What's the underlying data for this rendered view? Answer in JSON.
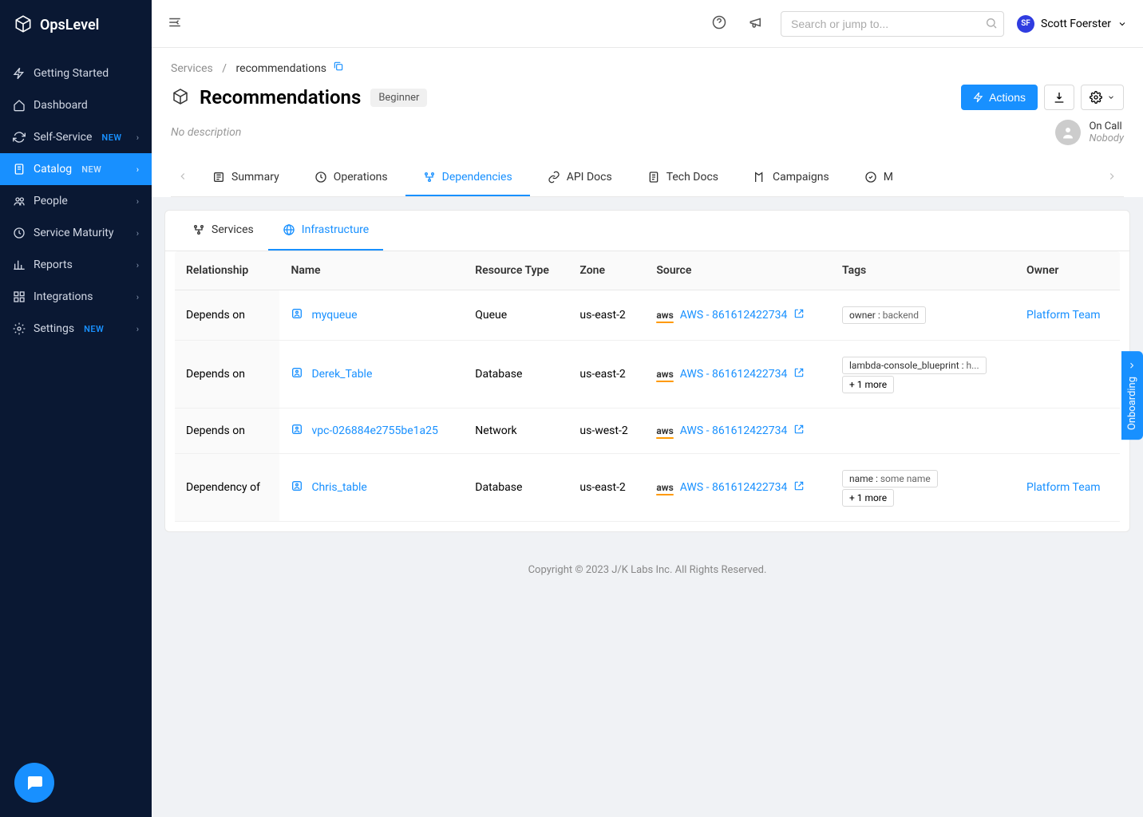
{
  "brand": "OpsLevel",
  "sidebar": {
    "items": [
      {
        "label": "Getting Started",
        "icon": "bolt",
        "chev": false,
        "new": false
      },
      {
        "label": "Dashboard",
        "icon": "home",
        "chev": false,
        "new": false
      },
      {
        "label": "Self-Service",
        "icon": "refresh",
        "chev": true,
        "new": true
      },
      {
        "label": "Catalog",
        "icon": "file",
        "chev": true,
        "new": true,
        "active": true
      },
      {
        "label": "People",
        "icon": "people",
        "chev": true,
        "new": false
      },
      {
        "label": "Service Maturity",
        "icon": "clock",
        "chev": true,
        "new": false
      },
      {
        "label": "Reports",
        "icon": "chart",
        "chev": true,
        "new": false
      },
      {
        "label": "Integrations",
        "icon": "grid",
        "chev": true,
        "new": false
      },
      {
        "label": "Settings",
        "icon": "gear",
        "chev": true,
        "new": true
      }
    ],
    "new_badge": "NEW"
  },
  "topbar": {
    "search_placeholder": "Search or jump to...",
    "user_initials": "SF",
    "user_name": "Scott Foerster"
  },
  "breadcrumb": {
    "parent": "Services",
    "current": "recommendations"
  },
  "page": {
    "title": "Recommendations",
    "tier": "Beginner",
    "description": "No description",
    "actions_label": "Actions",
    "oncall_label": "On Call",
    "oncall_value": "Nobody"
  },
  "tabs": [
    "Summary",
    "Operations",
    "Dependencies",
    "API Docs",
    "Tech Docs",
    "Campaigns",
    "M"
  ],
  "active_tab": 2,
  "subtabs": [
    "Services",
    "Infrastructure"
  ],
  "active_subtab": 1,
  "table": {
    "headers": [
      "Relationship",
      "Name",
      "Resource Type",
      "Zone",
      "Source",
      "Tags",
      "Owner"
    ],
    "rows": [
      {
        "relationship": "Depends on",
        "name": "myqueue",
        "resource_type": "Queue",
        "zone": "us-east-2",
        "source": "AWS - 861612422734",
        "tags": [
          {
            "k": "owner",
            "v": "backend"
          }
        ],
        "more": null,
        "owner": "Platform Team"
      },
      {
        "relationship": "Depends on",
        "name": "Derek_Table",
        "resource_type": "Database",
        "zone": "us-east-2",
        "source": "AWS - 861612422734",
        "tags": [
          {
            "k": "lambda-console_blueprint",
            "v": "h..."
          }
        ],
        "more": "+ 1 more",
        "owner": null
      },
      {
        "relationship": "Depends on",
        "name": "vpc-026884e2755be1a25",
        "resource_type": "Network",
        "zone": "us-west-2",
        "source": "AWS - 861612422734",
        "tags": [],
        "more": null,
        "owner": null
      },
      {
        "relationship": "Dependency of",
        "name": "Chris_table",
        "resource_type": "Database",
        "zone": "us-east-2",
        "source": "AWS - 861612422734",
        "tags": [
          {
            "k": "name",
            "v": "some name"
          }
        ],
        "more": "+ 1 more",
        "owner": "Platform Team"
      }
    ]
  },
  "footer": "Copyright © 2023 J/K Labs Inc. All Rights Reserved.",
  "onboarding": "Onboarding"
}
